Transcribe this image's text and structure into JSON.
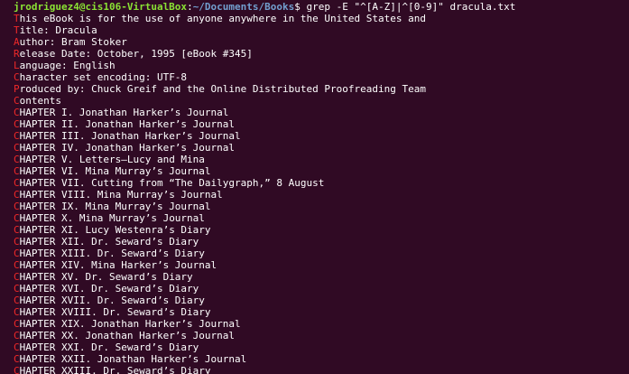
{
  "colors": {
    "background": "#300a24",
    "text": "#ffffff",
    "match": "#ef2929",
    "user_host": "#8ae234",
    "path": "#729fcf"
  },
  "prompt": {
    "user_host": "jrodriguez4@cis106-VirtualBox",
    "separator": ":",
    "path": "~/Documents/Books",
    "symbol": "$ ",
    "command": "grep -E \"^[A-Z]|^[0-9]\" dracula.txt"
  },
  "lines": [
    {
      "first": "T",
      "rest": "his eBook is for the use of anyone anywhere in the United States and"
    },
    {
      "first": "T",
      "rest": "itle: Dracula"
    },
    {
      "first": "A",
      "rest": "uthor: Bram Stoker"
    },
    {
      "first": "R",
      "rest": "elease Date: October, 1995 [eBook #345]"
    },
    {
      "first": "L",
      "rest": "anguage: English"
    },
    {
      "first": "C",
      "rest": "haracter set encoding: UTF-8"
    },
    {
      "first": "P",
      "rest": "roduced by: Chuck Greif and the Online Distributed Proofreading Team"
    },
    {
      "first": "C",
      "rest": "ontents"
    },
    {
      "first": "C",
      "rest": "HAPTER I. Jonathan Harker’s Journal"
    },
    {
      "first": "C",
      "rest": "HAPTER II. Jonathan Harker’s Journal"
    },
    {
      "first": "C",
      "rest": "HAPTER III. Jonathan Harker’s Journal"
    },
    {
      "first": "C",
      "rest": "HAPTER IV. Jonathan Harker’s Journal"
    },
    {
      "first": "C",
      "rest": "HAPTER V. Letters—Lucy and Mina"
    },
    {
      "first": "C",
      "rest": "HAPTER VI. Mina Murray’s Journal"
    },
    {
      "first": "C",
      "rest": "HAPTER VII. Cutting from “The Dailygraph,” 8 August"
    },
    {
      "first": "C",
      "rest": "HAPTER VIII. Mina Murray’s Journal"
    },
    {
      "first": "C",
      "rest": "HAPTER IX. Mina Murray’s Journal"
    },
    {
      "first": "C",
      "rest": "HAPTER X. Mina Murray’s Journal"
    },
    {
      "first": "C",
      "rest": "HAPTER XI. Lucy Westenra’s Diary"
    },
    {
      "first": "C",
      "rest": "HAPTER XII. Dr. Seward’s Diary"
    },
    {
      "first": "C",
      "rest": "HAPTER XIII. Dr. Seward’s Diary"
    },
    {
      "first": "C",
      "rest": "HAPTER XIV. Mina Harker’s Journal"
    },
    {
      "first": "C",
      "rest": "HAPTER XV. Dr. Seward’s Diary"
    },
    {
      "first": "C",
      "rest": "HAPTER XVI. Dr. Seward’s Diary"
    },
    {
      "first": "C",
      "rest": "HAPTER XVII. Dr. Seward’s Diary"
    },
    {
      "first": "C",
      "rest": "HAPTER XVIII. Dr. Seward’s Diary"
    },
    {
      "first": "C",
      "rest": "HAPTER XIX. Jonathan Harker’s Journal"
    },
    {
      "first": "C",
      "rest": "HAPTER XX. Jonathan Harker’s Journal"
    },
    {
      "first": "C",
      "rest": "HAPTER XXI. Dr. Seward’s Diary"
    },
    {
      "first": "C",
      "rest": "HAPTER XXII. Jonathan Harker’s Journal"
    },
    {
      "first": "C",
      "rest": "HAPTER XXIII. Dr. Seward’s Diary"
    }
  ]
}
